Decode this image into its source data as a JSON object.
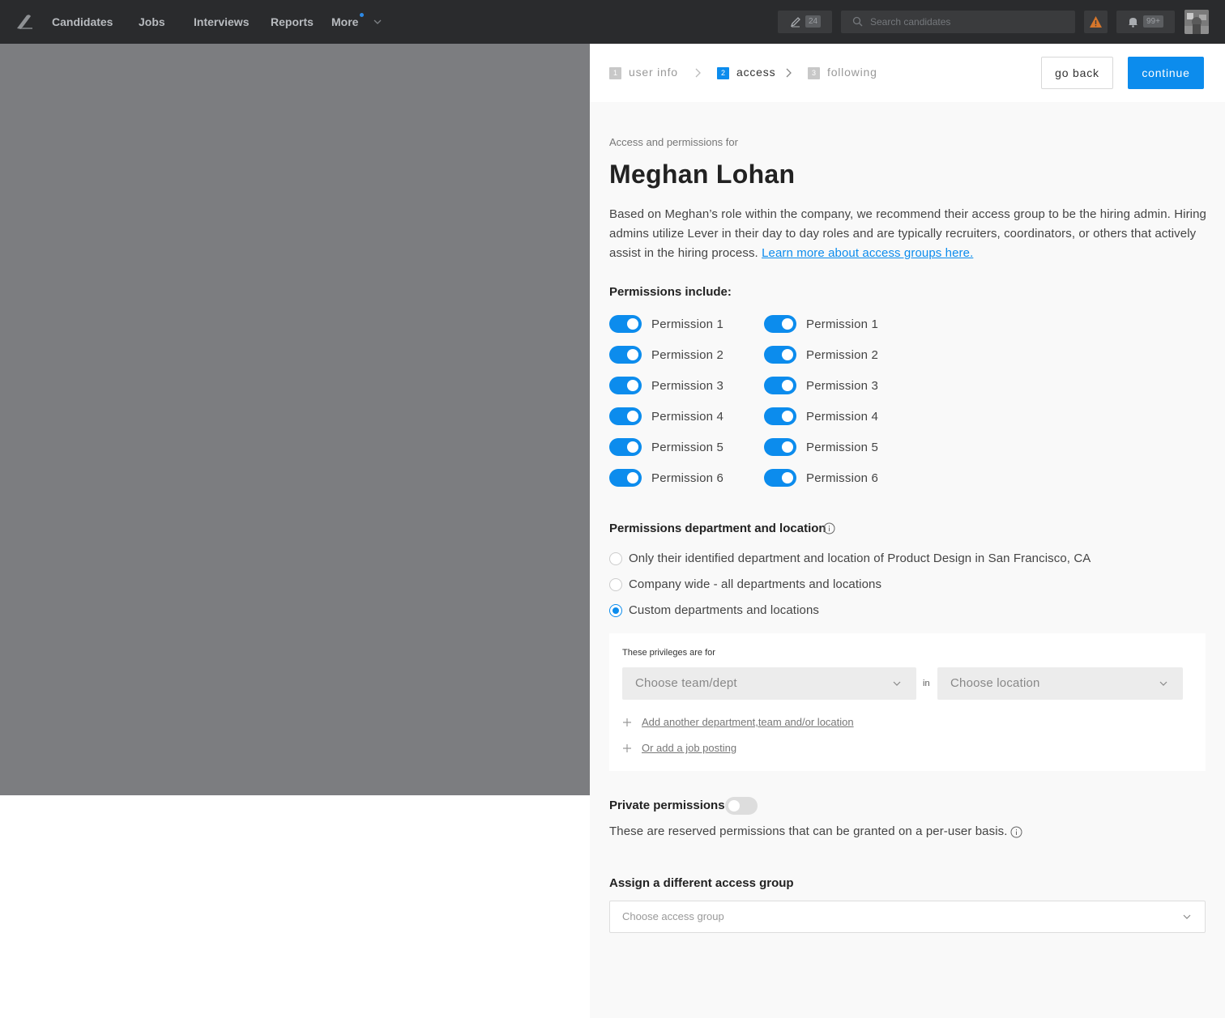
{
  "nav": {
    "items": [
      "Candidates",
      "Jobs",
      "Interviews",
      "Reports",
      "More"
    ],
    "compose_count": "24",
    "search_placeholder": "Search candidates",
    "notifications_count": "99+"
  },
  "steps": [
    {
      "num": "1",
      "label": "user info",
      "state": "done"
    },
    {
      "num": "2",
      "label": "access",
      "state": "active"
    },
    {
      "num": "3",
      "label": "following",
      "state": "pending"
    }
  ],
  "actions": {
    "back": "go back",
    "continue": "continue"
  },
  "header": {
    "eyebrow": "Access and permissions for",
    "name": "Meghan Lohan",
    "description": "Based on Meghan’s role within the company, we recommend their access group to be the hiring admin. Hiring admins utilize Lever in their day to day roles and are typically recruiters, coordinators, or others that actively assist in the hiring process. ",
    "learn_more": "Learn more about access groups here."
  },
  "permissions": {
    "title": "Permissions include:",
    "left": [
      "Permission 1",
      "Permission 2",
      "Permission 3",
      "Permission 4",
      "Permission 5",
      "Permission 6"
    ],
    "right": [
      "Permission 1",
      "Permission 2",
      "Permission 3",
      "Permission 4",
      "Permission 5",
      "Permission 6"
    ]
  },
  "scope": {
    "title": "Permissions department and location",
    "options": [
      {
        "label": "Only their identified department and location of Product Design in San Francisco, CA",
        "checked": false
      },
      {
        "label": "Company wide - all departments and locations",
        "checked": false
      },
      {
        "label": "Custom departments and locations",
        "checked": true
      }
    ],
    "custom": {
      "label": "These privileges are for",
      "team_placeholder": "Choose team/dept",
      "in": "in",
      "location_placeholder": "Choose location",
      "add_another": "Add another department,team and/or location",
      "add_posting": "Or add a job posting"
    }
  },
  "private": {
    "title": "Private permissions",
    "enabled": false,
    "description": "These are reserved permissions that can be granted on a per-user basis."
  },
  "access_group": {
    "title": "Assign a different access group",
    "placeholder": "Choose access group"
  },
  "colors": {
    "accent": "#0c8ced",
    "topbar": "#2a2b2d",
    "overlay": "#7c7d80",
    "warning": "#d6762b"
  }
}
